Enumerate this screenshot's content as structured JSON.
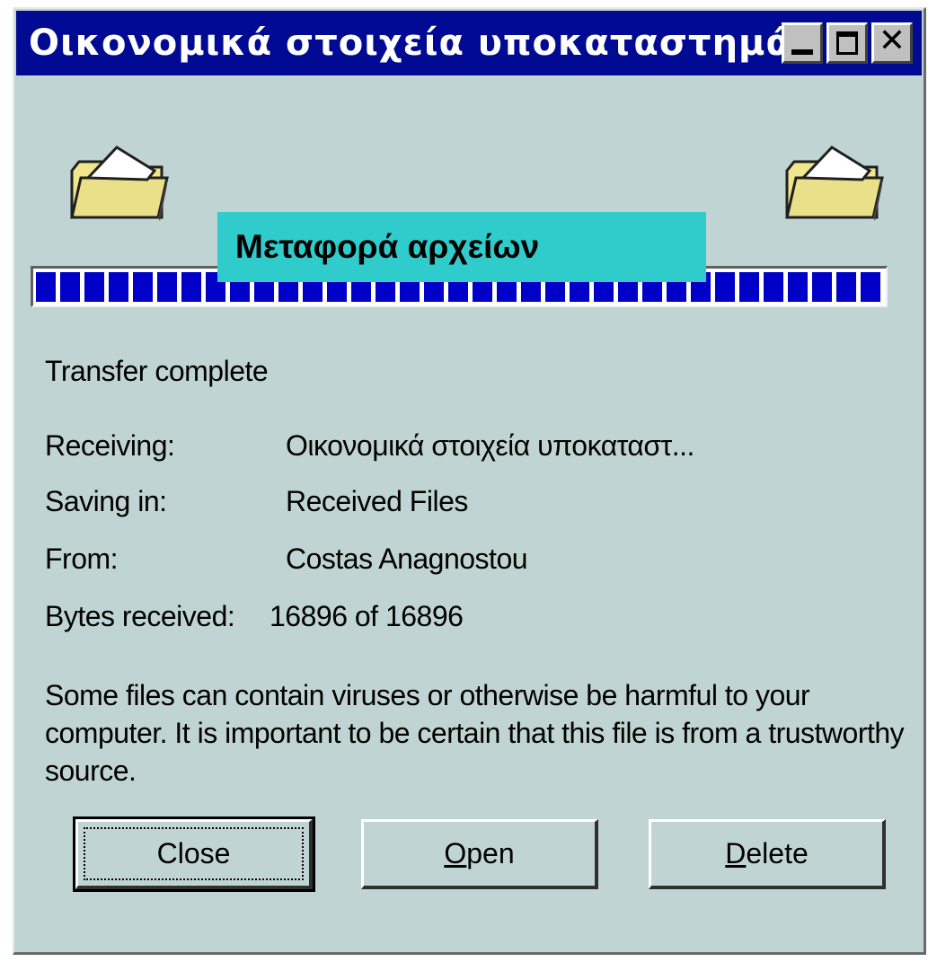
{
  "window": {
    "title": "Οικονομικά στοιχεία υποκαταστημάτ...",
    "minimize_label": "",
    "close_symbol": "✕"
  },
  "overlay_caption": "Μεταφορά αρχείων",
  "progress": {
    "percent": 100
  },
  "status": "Transfer complete",
  "details": {
    "receiving_label": "Receiving:",
    "receiving_value": "Οικονομικά στοιχεία υποκαταστ...",
    "saving_label": "Saving in:",
    "saving_value": "Received Files",
    "from_label": "From:",
    "from_value": "Costas Anagnostou",
    "bytes_label": "Bytes received:",
    "bytes_value": "16896 of 16896"
  },
  "warning_text": "Some files can contain viruses or otherwise be harmful to your computer. It is important to be certain that this file is from a trustworthy source.",
  "buttons": {
    "close": "Close",
    "open_first": "O",
    "open_rest": "pen",
    "delete_first": "D",
    "delete_rest": "elete"
  },
  "colors": {
    "titlebar": "#000a92",
    "dialog_bg": "#c0d5d3",
    "progress_block": "#0000c8",
    "overlay": "#30cccc"
  },
  "icons": [
    "folder-icon",
    "folder-icon"
  ]
}
